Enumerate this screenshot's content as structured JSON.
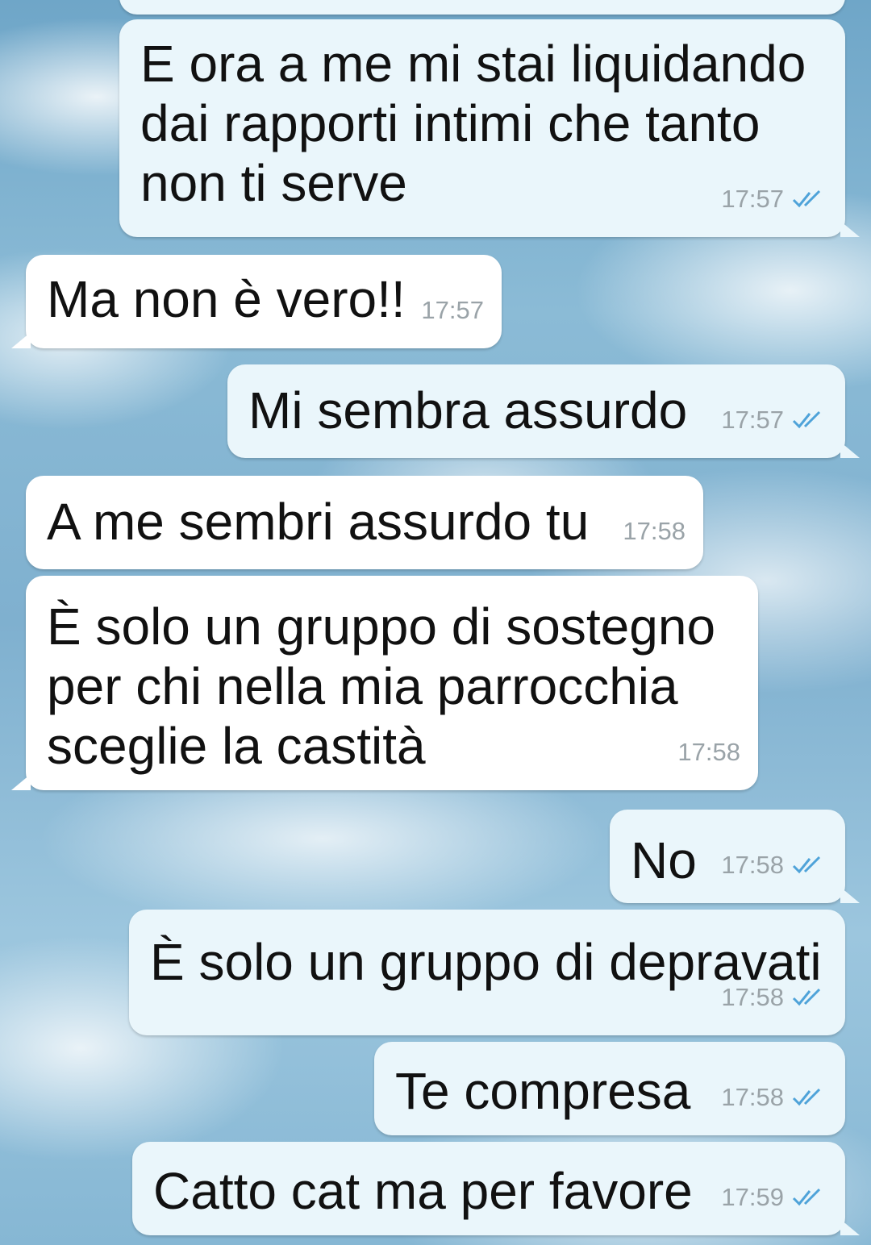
{
  "messages": [
    {
      "id": "m1",
      "dir": "out",
      "text": "E ora a me mi stai liquidando\ndai rapporti intimi che tanto\nnon ti serve",
      "time": "17:57",
      "read": true
    },
    {
      "id": "m2",
      "dir": "in",
      "text": "Ma non è vero!!",
      "time": "17:57"
    },
    {
      "id": "m3",
      "dir": "out",
      "text": "Mi sembra assurdo",
      "time": "17:57",
      "read": true
    },
    {
      "id": "m4",
      "dir": "in",
      "text": "A me sembri assurdo tu",
      "time": "17:58"
    },
    {
      "id": "m5",
      "dir": "in",
      "text": "È solo un gruppo di sostegno\nper chi nella mia parrocchia\nsceglie la castità",
      "time": "17:58"
    },
    {
      "id": "m6",
      "dir": "out",
      "text": "No",
      "time": "17:58",
      "read": true
    },
    {
      "id": "m7",
      "dir": "out",
      "text": "È solo un gruppo di depravati",
      "time": "17:58",
      "read": true
    },
    {
      "id": "m8",
      "dir": "out",
      "text": "Te compresa",
      "time": "17:58",
      "read": true
    },
    {
      "id": "m9",
      "dir": "out",
      "text": "Catto cat ma per favore",
      "time": "17:59",
      "read": true
    }
  ],
  "colors": {
    "read_tick": "#4fa3d9",
    "bubble_out": "#eaf6fb",
    "bubble_in": "#ffffff"
  },
  "icons": {
    "read_receipt": "double-check-icon"
  }
}
